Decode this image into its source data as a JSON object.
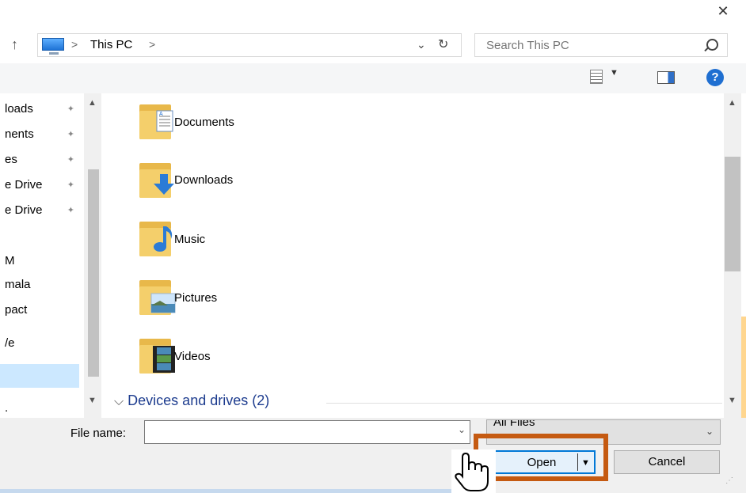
{
  "window": {
    "close_symbol": "✕"
  },
  "address": {
    "crumb": "This PC",
    "separator": ">",
    "up_symbol": "↑",
    "dropdown_symbol": "⌄",
    "refresh_symbol": "↻"
  },
  "search": {
    "placeholder": "Search This PC"
  },
  "toolbar": {
    "view_dropdown_symbol": "▼",
    "help_symbol": "?"
  },
  "nav": {
    "items": [
      "loads",
      "nents",
      "es",
      "e Drive",
      "e Drive",
      "M",
      "mala",
      "pact",
      "/e",
      "",
      "."
    ],
    "pinned": [
      true,
      true,
      true,
      true,
      true,
      false,
      false,
      false,
      false,
      false,
      false
    ],
    "pin_symbol": "📌",
    "selected_index": 9
  },
  "folders": [
    {
      "label": "Documents",
      "icon": "documents-icon"
    },
    {
      "label": "Downloads",
      "icon": "downloads-icon"
    },
    {
      "label": "Music",
      "icon": "music-icon"
    },
    {
      "label": "Pictures",
      "icon": "pictures-icon"
    },
    {
      "label": "Videos",
      "icon": "videos-icon"
    }
  ],
  "section": {
    "label": "Devices and drives (2)",
    "chevron": "⌵"
  },
  "bottom": {
    "file_name_label": "File name:",
    "file_name_value": "",
    "filter_value": "All Files",
    "open_label": "Open",
    "cancel_label": "Cancel"
  },
  "colors": {
    "highlight": "#c55a11",
    "folder": "#f4cf6b",
    "accent": "#0078d7"
  }
}
